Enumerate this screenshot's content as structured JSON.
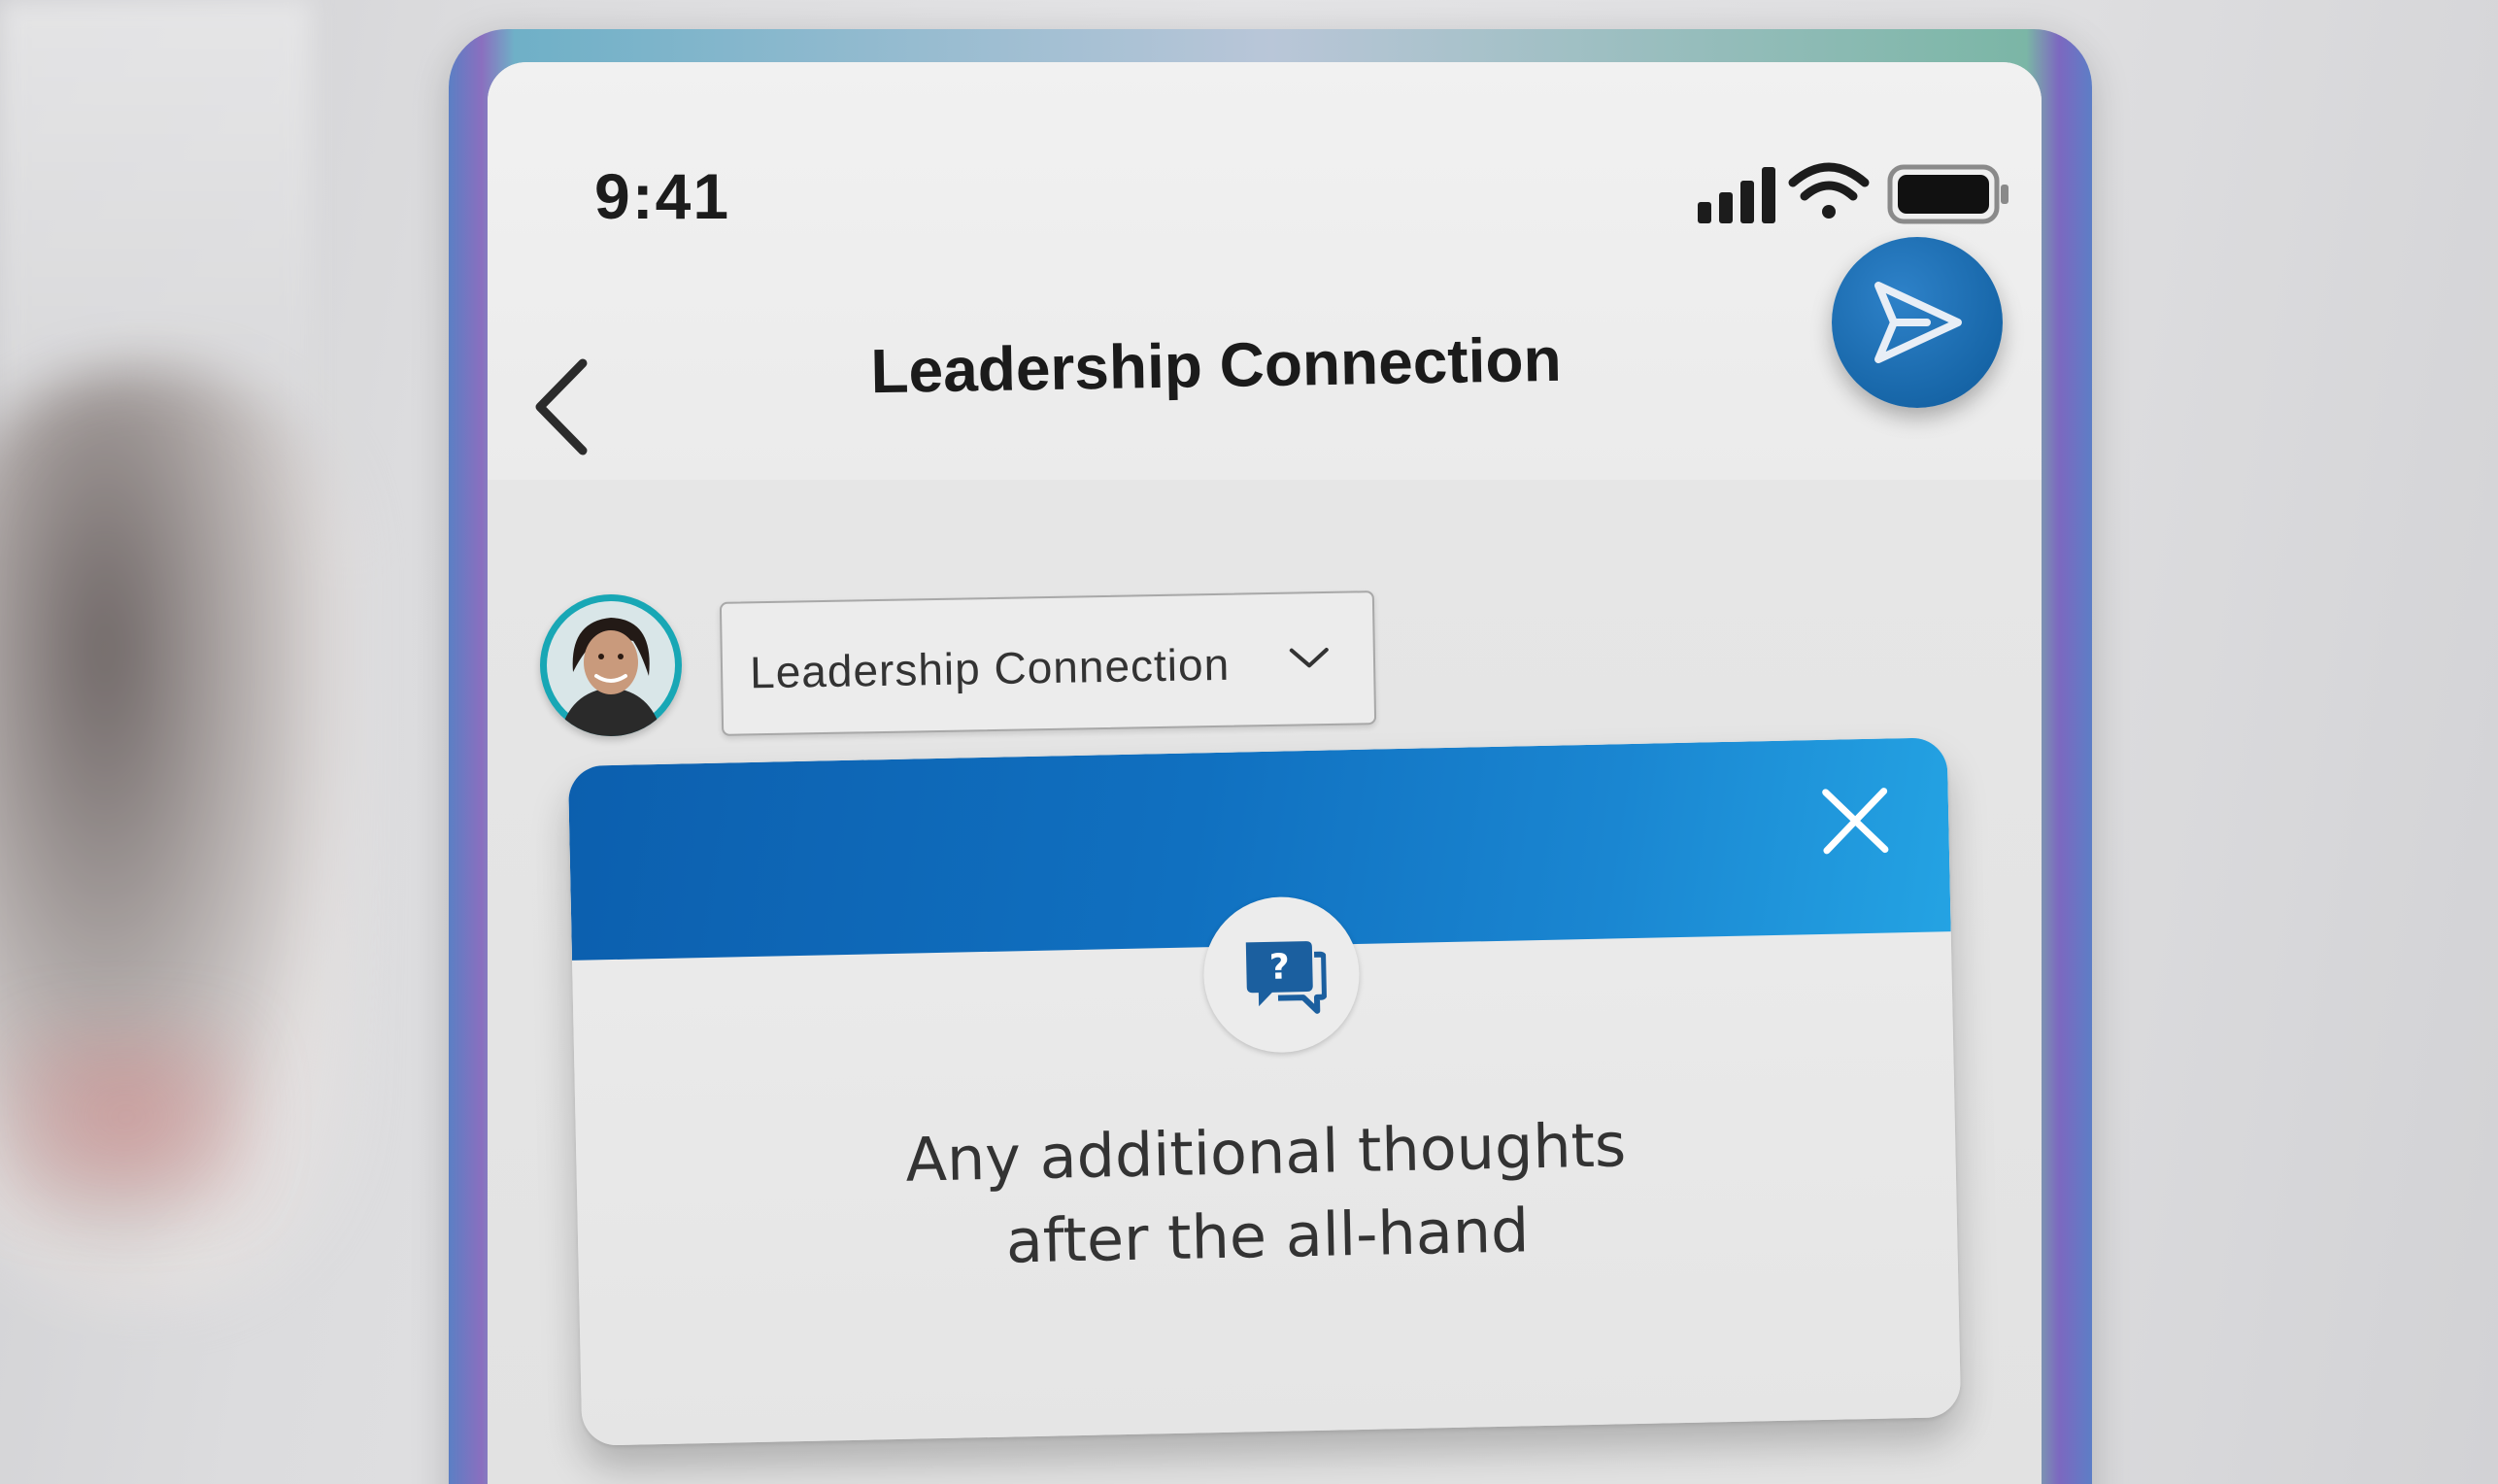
{
  "status_bar": {
    "time": "9:41",
    "icons": [
      "cellular-signal-icon",
      "wifi-icon",
      "battery-icon"
    ]
  },
  "header": {
    "back_icon": "chevron-left-icon",
    "title": "Leadership Connection",
    "send_icon": "paper-plane-icon"
  },
  "composer": {
    "avatar": "user-avatar",
    "audience_select": {
      "selected": "Leadership Connection",
      "icon": "chevron-down-icon"
    }
  },
  "prompt_card": {
    "close_icon": "close-icon",
    "badge_icon": "question-chat-icon",
    "badge_glyph": "?",
    "message_line1": "Any additional thoughts",
    "message_line2": "after the all-hand"
  },
  "colors": {
    "accent": "#1668b4",
    "header_bg": "#eeeeee",
    "card_header": "#1070c0"
  }
}
